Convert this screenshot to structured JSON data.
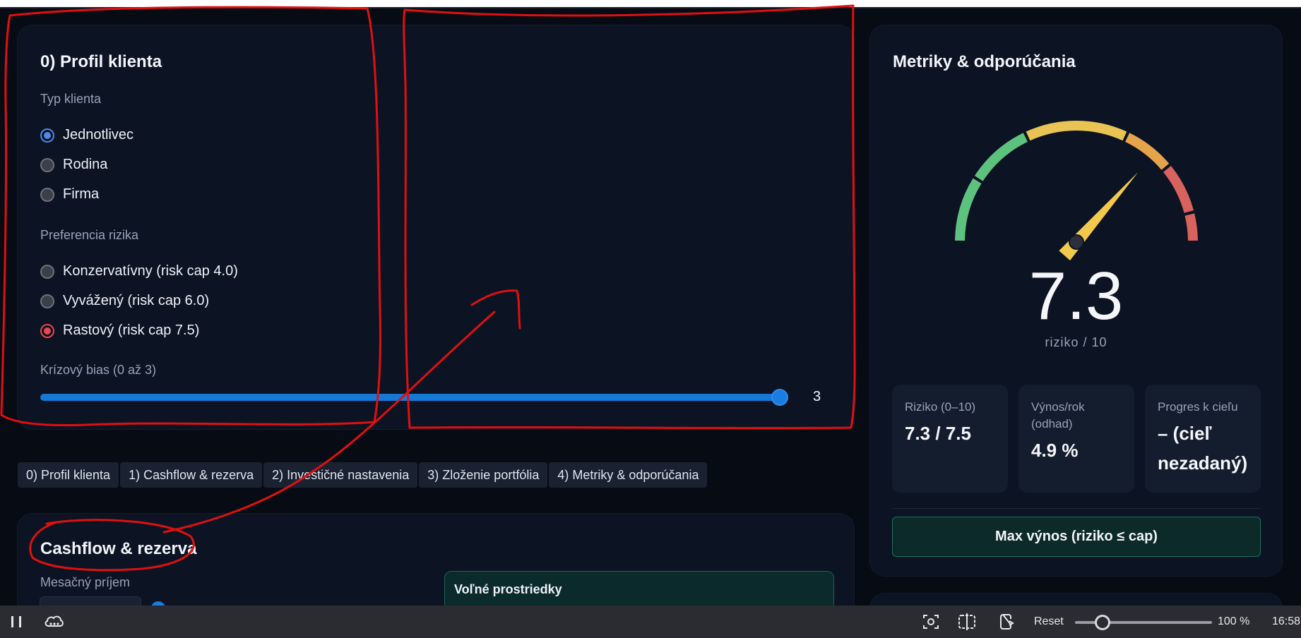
{
  "profile": {
    "title": "0) Profil klienta",
    "client_type_label": "Typ klienta",
    "client_types": [
      {
        "label": "Jednotlivec",
        "checked": true
      },
      {
        "label": "Rodina",
        "checked": false
      },
      {
        "label": "Firma",
        "checked": false
      }
    ],
    "risk_pref_label": "Preferencia rizika",
    "risk_prefs": [
      {
        "label": "Konzervatívny (risk cap 4.0)",
        "checked": false
      },
      {
        "label": "Vyvážený (risk cap 6.0)",
        "checked": false
      },
      {
        "label": "Rastový (risk cap 7.5)",
        "checked": true
      }
    ],
    "crisis_bias_label": "Krízový bias (0 až 3)",
    "crisis_bias_value": "3",
    "crisis_bias_fraction": 1.0
  },
  "tabs": [
    "0) Profil klienta",
    "1) Cashflow & rezerva",
    "2) Investičné nastavenia",
    "3) Zloženie portfólia",
    "4) Metriky & odporúčania"
  ],
  "cashflow": {
    "title": "Cashflow & rezerva",
    "monthly_income_label": "Mesačný príjem",
    "free_funds_label": "Voľné prostriedky"
  },
  "metrics": {
    "title": "Metriky & odporúčania",
    "gauge_value": "7.3",
    "gauge_value_numeric": 7.3,
    "gauge_max": 10,
    "gauge_caption": "riziko / 10",
    "stats": [
      {
        "label": "Riziko (0–10)",
        "value": "7.3 / 7.5"
      },
      {
        "label": "Výnos/rok (odhad)",
        "value": "4.9 %"
      },
      {
        "label": "Progres k cieľu",
        "value": "– (cieľ nezadaný)"
      }
    ],
    "max_button_label": "Max výnos (riziko ≤ cap)"
  },
  "colors": {
    "accent_blue": "#1a7de0",
    "radio_red": "#e8484e",
    "gauge_green": "#5ec27f",
    "gauge_yellow": "#e9c454",
    "gauge_orange": "#e5a34c",
    "gauge_red": "#d7625e",
    "annotation_red": "#e01010"
  },
  "taskbar": {
    "reset_label": "Reset",
    "zoom_label": "100 %",
    "zoom_fraction": 0.18,
    "time": "16:58",
    "icons": [
      "pause-icon",
      "cloud-icon",
      "screenshot-icon",
      "split-icon",
      "phone-link-icon"
    ]
  }
}
